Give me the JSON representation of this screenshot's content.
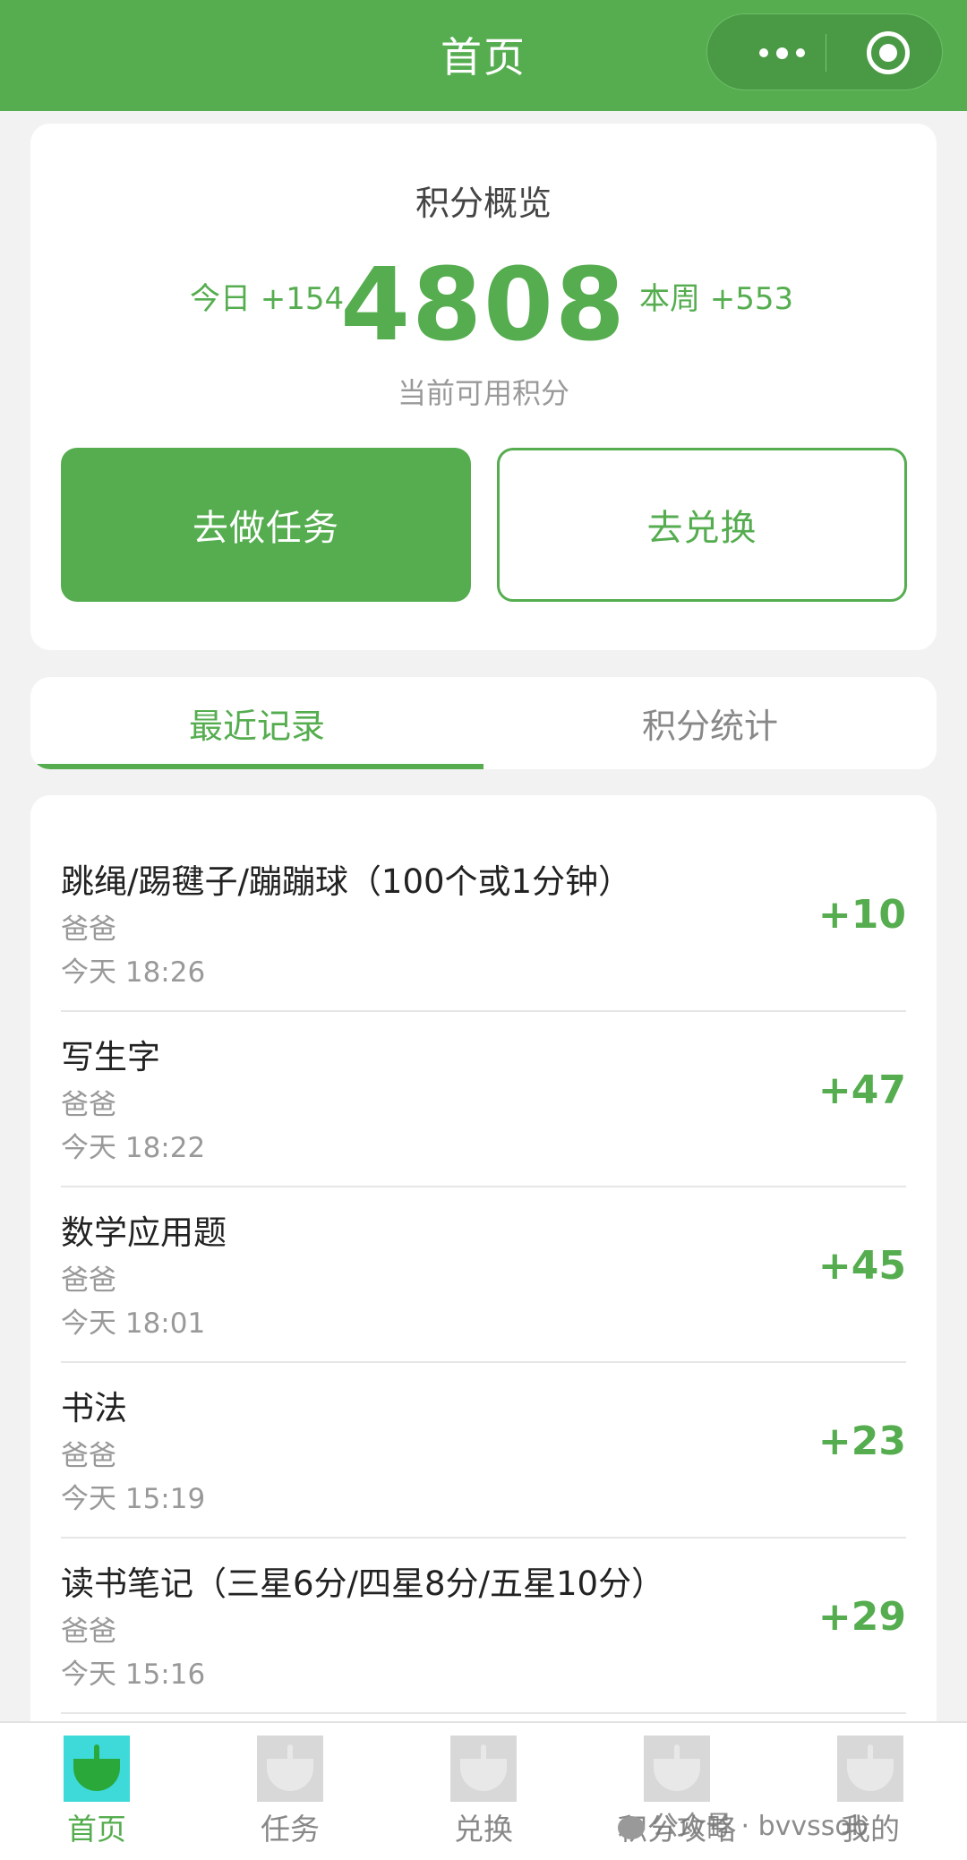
{
  "nav": {
    "title": "首页"
  },
  "overview": {
    "title": "积分概览",
    "today": "今日 +154",
    "points": "4808",
    "week": "本周 +553",
    "subtitle": "当前可用积分",
    "task_button": "去做任务",
    "exchange_button": "去兑换"
  },
  "tabs": {
    "recent": "最近记录",
    "stats": "积分统计"
  },
  "records": [
    {
      "title": "跳绳/踢毽子/蹦蹦球（100个或1分钟）",
      "by": "爸爸",
      "time": "今天 18:26",
      "points": "+10"
    },
    {
      "title": "写生字",
      "by": "爸爸",
      "time": "今天 18:22",
      "points": "+47"
    },
    {
      "title": "数学应用题",
      "by": "爸爸",
      "time": "今天 18:01",
      "points": "+45"
    },
    {
      "title": "书法",
      "by": "爸爸",
      "time": "今天 15:19",
      "points": "+23"
    },
    {
      "title": "读书笔记（三星6分/四星8分/五星10分）",
      "by": "爸爸",
      "time": "今天 15:16",
      "points": "+29"
    }
  ],
  "tabbar": [
    {
      "label": "首页",
      "icon": "sprout-icon",
      "active": true
    },
    {
      "label": "任务",
      "icon": "sprout-icon",
      "active": false
    },
    {
      "label": "兑换",
      "icon": "sprout-icon",
      "active": false
    },
    {
      "label": "积分攻略",
      "icon": "sprout-icon",
      "active": false
    },
    {
      "label": "我的",
      "icon": "sprout-icon",
      "active": false
    }
  ],
  "watermark": "公众号 · bvvssob",
  "colors": {
    "accent": "#55ad4f",
    "background": "#f2f2f2",
    "divider": "#e6e6e6"
  }
}
